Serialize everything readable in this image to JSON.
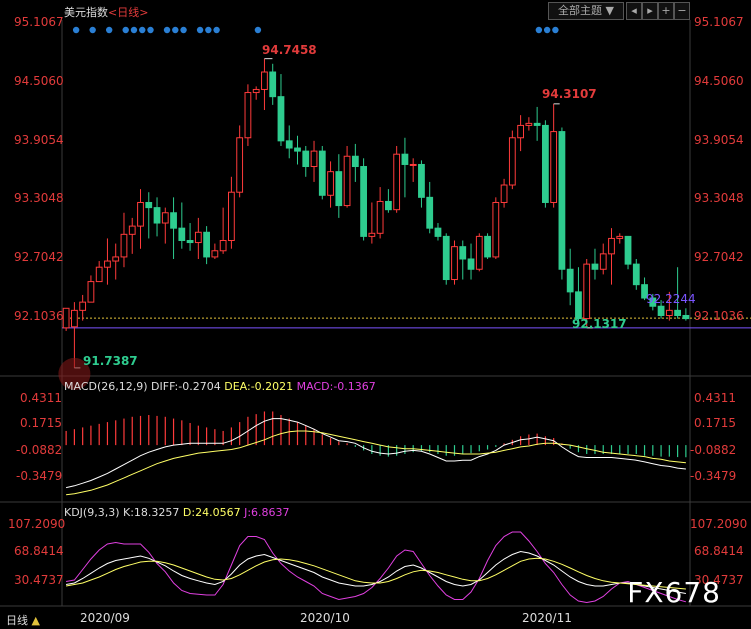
{
  "header": {
    "title": "美元指数",
    "period": "<日线>",
    "theme_select": "全部主题",
    "theme_arrow": "▼"
  },
  "price_axis": {
    "labels": [
      "95.1067",
      "94.5060",
      "93.9054",
      "93.3048",
      "92.7042",
      "92.1036"
    ]
  },
  "annotations": {
    "high": "94.7458",
    "high2": "94.3107",
    "low": "91.7387",
    "low2": "92.1317",
    "current": "92.2244"
  },
  "macd": {
    "header": "MACD(26,12,9)",
    "diff": "DIFF:-0.2704",
    "dea": "DEA:-0.2021",
    "macd": "MACD:-0.1367",
    "axis_labels": [
      "0.4311",
      "0.1715",
      "-0.0882",
      "-0.3479"
    ]
  },
  "kdj": {
    "header": "KDJ(9,3,3)",
    "k": "K:18.3257",
    "d": "D:24.0567",
    "j": "J:6.8637",
    "axis_labels": [
      "107.2090",
      "68.8414",
      "30.4737"
    ]
  },
  "footer": {
    "period_label": "日线",
    "dates": [
      "2020/09",
      "2020/10",
      "2020/11"
    ]
  },
  "watermark": "FX678",
  "colors": {
    "up": "#ff3b3b",
    "down": "#2ecc8f",
    "axis_text": "#e23b3b",
    "kline_line": "#ffffff",
    "dea_line": "#ffff66",
    "j_line": "#e040e0",
    "dot": "#2a7fd4"
  },
  "chart_data": {
    "type": "candlestick",
    "date_labels": [
      "2020/09",
      "2020/10",
      "2020/11"
    ],
    "price_ylim": [
      91.7,
      95.1067
    ],
    "candles": [
      [
        92.13,
        92.28,
        92.1,
        92.32
      ],
      [
        92.14,
        91.74,
        92.38,
        92.3
      ],
      [
        92.3,
        92.2,
        92.45,
        92.38
      ],
      [
        92.38,
        92.5,
        92.64,
        92.58
      ],
      [
        92.58,
        92.6,
        92.78,
        92.72
      ],
      [
        92.72,
        92.55,
        93.0,
        92.78
      ],
      [
        92.78,
        92.6,
        92.95,
        92.82
      ],
      [
        92.82,
        92.72,
        93.25,
        93.04
      ],
      [
        93.04,
        92.85,
        93.2,
        93.12
      ],
      [
        93.12,
        92.9,
        93.48,
        93.35
      ],
      [
        93.35,
        93.0,
        93.45,
        93.3
      ],
      [
        93.3,
        93.02,
        93.4,
        93.15
      ],
      [
        93.15,
        92.95,
        93.3,
        93.25
      ],
      [
        93.25,
        92.8,
        93.4,
        93.1
      ],
      [
        93.1,
        92.9,
        93.35,
        92.98
      ],
      [
        92.98,
        92.88,
        93.15,
        92.96
      ],
      [
        92.96,
        92.8,
        93.2,
        93.06
      ],
      [
        93.06,
        92.75,
        93.12,
        92.82
      ],
      [
        92.82,
        92.8,
        92.95,
        92.88
      ],
      [
        92.88,
        92.85,
        93.3,
        92.98
      ],
      [
        92.98,
        92.9,
        93.6,
        93.45
      ],
      [
        93.45,
        93.4,
        94.1,
        93.98
      ],
      [
        93.98,
        93.9,
        94.5,
        94.42
      ],
      [
        94.42,
        94.35,
        94.48,
        94.45
      ],
      [
        94.45,
        94.25,
        94.75,
        94.62
      ],
      [
        94.62,
        94.3,
        94.7,
        94.38
      ],
      [
        94.38,
        93.9,
        94.6,
        93.95
      ],
      [
        93.95,
        93.78,
        94.1,
        93.88
      ],
      [
        93.88,
        93.72,
        94.0,
        93.85
      ],
      [
        93.85,
        93.6,
        93.9,
        93.7
      ],
      [
        93.7,
        93.55,
        93.95,
        93.85
      ],
      [
        93.85,
        93.38,
        93.9,
        93.42
      ],
      [
        93.42,
        93.3,
        93.75,
        93.65
      ],
      [
        93.65,
        93.2,
        93.82,
        93.32
      ],
      [
        93.32,
        93.3,
        93.9,
        93.8
      ],
      [
        93.8,
        93.55,
        93.92,
        93.7
      ],
      [
        93.7,
        92.98,
        93.78,
        93.02
      ],
      [
        93.02,
        92.95,
        93.35,
        93.05
      ],
      [
        93.05,
        93.0,
        93.5,
        93.36
      ],
      [
        93.36,
        93.25,
        93.48,
        93.28
      ],
      [
        93.28,
        93.25,
        93.9,
        93.82
      ],
      [
        93.82,
        93.4,
        93.98,
        93.72
      ],
      [
        93.72,
        93.55,
        93.78,
        93.72
      ],
      [
        93.72,
        93.3,
        93.76,
        93.4
      ],
      [
        93.4,
        93.05,
        93.55,
        93.1
      ],
      [
        93.1,
        92.98,
        93.15,
        93.02
      ],
      [
        93.02,
        92.55,
        93.05,
        92.6
      ],
      [
        92.6,
        92.55,
        92.98,
        92.92
      ],
      [
        92.92,
        92.6,
        92.98,
        92.8
      ],
      [
        92.8,
        92.6,
        92.95,
        92.7
      ],
      [
        92.7,
        92.68,
        93.05,
        93.02
      ],
      [
        93.02,
        92.8,
        93.05,
        92.82
      ],
      [
        92.82,
        92.8,
        93.4,
        93.35
      ],
      [
        93.35,
        93.3,
        93.58,
        93.52
      ],
      [
        93.52,
        93.48,
        94.05,
        93.98
      ],
      [
        93.98,
        93.85,
        94.2,
        94.1
      ],
      [
        94.1,
        94.05,
        94.18,
        94.12
      ],
      [
        94.12,
        93.95,
        94.28,
        94.1
      ],
      [
        94.1,
        93.3,
        94.15,
        93.35
      ],
      [
        93.35,
        93.3,
        94.31,
        94.04
      ],
      [
        94.04,
        92.6,
        94.08,
        92.7
      ],
      [
        92.7,
        92.35,
        92.9,
        92.48
      ],
      [
        92.48,
        92.18,
        92.72,
        92.22
      ],
      [
        92.22,
        92.13,
        92.8,
        92.75
      ],
      [
        92.75,
        92.6,
        92.9,
        92.7
      ],
      [
        92.7,
        92.65,
        92.95,
        92.85
      ],
      [
        92.85,
        92.55,
        93.1,
        93.0
      ],
      [
        93.0,
        92.95,
        93.05,
        93.02
      ],
      [
        93.02,
        92.7,
        93.0,
        92.75
      ],
      [
        92.75,
        92.5,
        92.8,
        92.55
      ],
      [
        92.55,
        92.4,
        92.62,
        92.42
      ],
      [
        92.42,
        92.3,
        92.46,
        92.34
      ],
      [
        92.34,
        92.22,
        92.4,
        92.25
      ],
      [
        92.25,
        92.2,
        92.48,
        92.3
      ],
      [
        92.3,
        92.22,
        92.72,
        92.25
      ],
      [
        92.25,
        92.2,
        92.32,
        92.22
      ]
    ],
    "macd_ylim": [
      -0.62,
      0.6
    ],
    "macd_hist": [
      0.16,
      0.18,
      0.2,
      0.22,
      0.24,
      0.26,
      0.28,
      0.3,
      0.32,
      0.33,
      0.34,
      0.33,
      0.32,
      0.3,
      0.28,
      0.25,
      0.22,
      0.2,
      0.18,
      0.16,
      0.2,
      0.26,
      0.32,
      0.35,
      0.38,
      0.38,
      0.34,
      0.3,
      0.26,
      0.22,
      0.18,
      0.12,
      0.08,
      0.04,
      0.02,
      -0.02,
      -0.06,
      -0.1,
      -0.12,
      -0.13,
      -0.12,
      -0.1,
      -0.08,
      -0.07,
      -0.08,
      -0.1,
      -0.12,
      -0.12,
      -0.1,
      -0.09,
      -0.07,
      -0.05,
      -0.02,
      0.02,
      0.06,
      0.1,
      0.12,
      0.13,
      0.1,
      0.08,
      0.02,
      -0.04,
      -0.08,
      -0.1,
      -0.1,
      -0.1,
      -0.1,
      -0.1,
      -0.1,
      -0.1,
      -0.12,
      -0.12,
      -0.13,
      -0.13,
      -0.135,
      -0.137
    ],
    "diff_line": [
      -0.48,
      -0.46,
      -0.43,
      -0.4,
      -0.36,
      -0.32,
      -0.27,
      -0.22,
      -0.17,
      -0.12,
      -0.08,
      -0.05,
      -0.02,
      0.0,
      0.01,
      0.02,
      0.02,
      0.02,
      0.02,
      0.02,
      0.05,
      0.1,
      0.16,
      0.22,
      0.27,
      0.3,
      0.3,
      0.28,
      0.26,
      0.22,
      0.18,
      0.13,
      0.09,
      0.05,
      0.04,
      0.02,
      -0.03,
      -0.07,
      -0.09,
      -0.1,
      -0.09,
      -0.07,
      -0.06,
      -0.07,
      -0.1,
      -0.14,
      -0.18,
      -0.18,
      -0.17,
      -0.17,
      -0.13,
      -0.1,
      -0.06,
      0.0,
      0.03,
      0.06,
      0.07,
      0.09,
      0.07,
      0.05,
      -0.02,
      -0.08,
      -0.13,
      -0.14,
      -0.14,
      -0.14,
      -0.14,
      -0.15,
      -0.16,
      -0.17,
      -0.19,
      -0.21,
      -0.23,
      -0.24,
      -0.26,
      -0.27
    ],
    "dea_line": [
      -0.56,
      -0.55,
      -0.53,
      -0.51,
      -0.48,
      -0.45,
      -0.41,
      -0.37,
      -0.33,
      -0.29,
      -0.25,
      -0.21,
      -0.18,
      -0.15,
      -0.13,
      -0.11,
      -0.09,
      -0.08,
      -0.07,
      -0.06,
      -0.05,
      -0.03,
      0.0,
      0.03,
      0.06,
      0.1,
      0.13,
      0.15,
      0.16,
      0.16,
      0.15,
      0.14,
      0.12,
      0.1,
      0.08,
      0.06,
      0.04,
      0.02,
      0.0,
      -0.02,
      -0.03,
      -0.04,
      -0.04,
      -0.05,
      -0.06,
      -0.07,
      -0.08,
      -0.09,
      -0.1,
      -0.1,
      -0.1,
      -0.09,
      -0.08,
      -0.06,
      -0.04,
      -0.02,
      -0.01,
      0.01,
      0.02,
      0.02,
      0.01,
      0.0,
      -0.02,
      -0.04,
      -0.06,
      -0.08,
      -0.09,
      -0.1,
      -0.11,
      -0.12,
      -0.13,
      -0.15,
      -0.16,
      -0.18,
      -0.19,
      -0.2
    ],
    "kdj_ylim": [
      4,
      116
    ],
    "k_line": [
      30,
      32,
      38,
      45,
      52,
      58,
      62,
      64,
      66,
      68,
      65,
      60,
      55,
      48,
      42,
      38,
      35,
      32,
      30,
      34,
      44,
      56,
      64,
      68,
      70,
      66,
      62,
      58,
      54,
      50,
      46,
      40,
      36,
      32,
      30,
      28,
      28,
      30,
      34,
      40,
      48,
      54,
      56,
      52,
      46,
      40,
      34,
      30,
      28,
      30,
      36,
      46,
      56,
      64,
      70,
      74,
      72,
      68,
      62,
      56,
      48,
      40,
      34,
      30,
      28,
      28,
      30,
      32,
      32,
      30,
      28,
      26,
      24,
      22,
      20,
      18
    ],
    "d_line": [
      28,
      30,
      32,
      36,
      40,
      45,
      50,
      54,
      57,
      60,
      61,
      61,
      59,
      56,
      52,
      48,
      44,
      40,
      37,
      36,
      38,
      43,
      49,
      55,
      60,
      63,
      64,
      63,
      61,
      58,
      55,
      51,
      47,
      43,
      39,
      35,
      33,
      32,
      32,
      34,
      38,
      43,
      47,
      49,
      48,
      46,
      43,
      40,
      37,
      35,
      35,
      38,
      43,
      49,
      55,
      61,
      64,
      65,
      64,
      61,
      57,
      52,
      47,
      42,
      38,
      35,
      33,
      32,
      31,
      30,
      29,
      28,
      27,
      26,
      25,
      24
    ],
    "j_line": [
      34,
      36,
      50,
      64,
      76,
      84,
      86,
      84,
      84,
      84,
      73,
      58,
      47,
      32,
      22,
      18,
      17,
      16,
      16,
      30,
      56,
      82,
      94,
      94,
      90,
      72,
      58,
      48,
      40,
      34,
      28,
      18,
      14,
      10,
      12,
      14,
      18,
      26,
      38,
      52,
      68,
      76,
      74,
      58,
      42,
      28,
      16,
      10,
      10,
      20,
      38,
      62,
      82,
      94,
      100,
      100,
      88,
      74,
      58,
      46,
      30,
      16,
      8,
      6,
      8,
      14,
      24,
      32,
      34,
      30,
      26,
      22,
      18,
      14,
      10,
      7
    ],
    "signal_dots": [
      0,
      2,
      4,
      6,
      7,
      8,
      9,
      11,
      12,
      13,
      15,
      16,
      17,
      22,
      56,
      57,
      58
    ]
  }
}
